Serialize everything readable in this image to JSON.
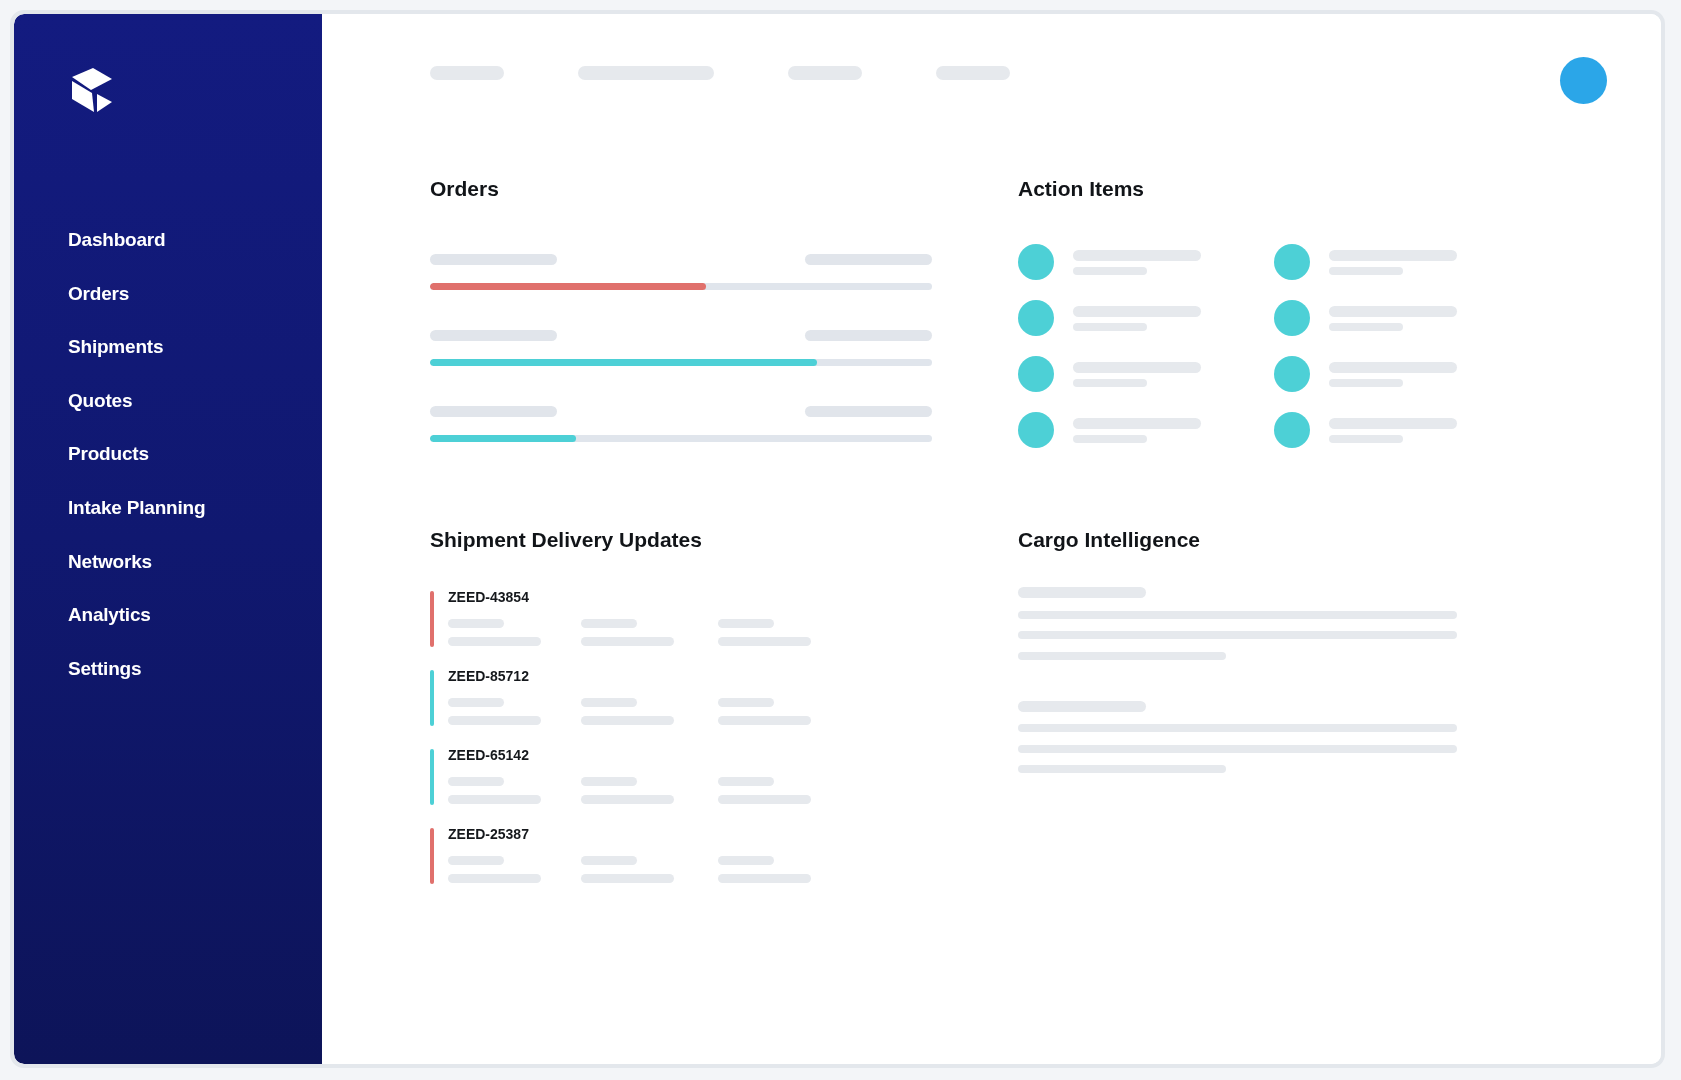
{
  "sidebar": {
    "items": [
      {
        "label": "Dashboard",
        "selected": false
      },
      {
        "label": "Orders",
        "selected": false
      },
      {
        "label": "Shipments",
        "selected": false
      },
      {
        "label": "Quotes",
        "selected": false
      },
      {
        "label": "Products",
        "selected": false
      },
      {
        "label": "Intake Planning",
        "selected": false
      },
      {
        "label": "Networks",
        "selected": false
      },
      {
        "label": "Analytics",
        "selected": false
      },
      {
        "label": "Settings",
        "selected": false
      }
    ]
  },
  "orders": {
    "title": "Orders",
    "rows": [
      {
        "level": 0.55,
        "color": "#e0706c"
      },
      {
        "level": 0.77,
        "color": "#4dd0d6"
      },
      {
        "level": 0.29,
        "color": "#4dd0d6"
      }
    ]
  },
  "action_items": {
    "title": "Action Items"
  },
  "shipment_delivery_updates": {
    "title": "Shipment Delivery Updates",
    "items": [
      {
        "id": "ZEED-43854",
        "color": "#e0706c"
      },
      {
        "id": "ZEED-85712",
        "color": "#4dd0d6"
      },
      {
        "id": "ZEED-65142",
        "color": "#4dd0d6"
      },
      {
        "id": "ZEED-25387",
        "color": "#e0706c"
      }
    ]
  },
  "cargo_intelligence": {
    "title": "Cargo Intelligence"
  }
}
